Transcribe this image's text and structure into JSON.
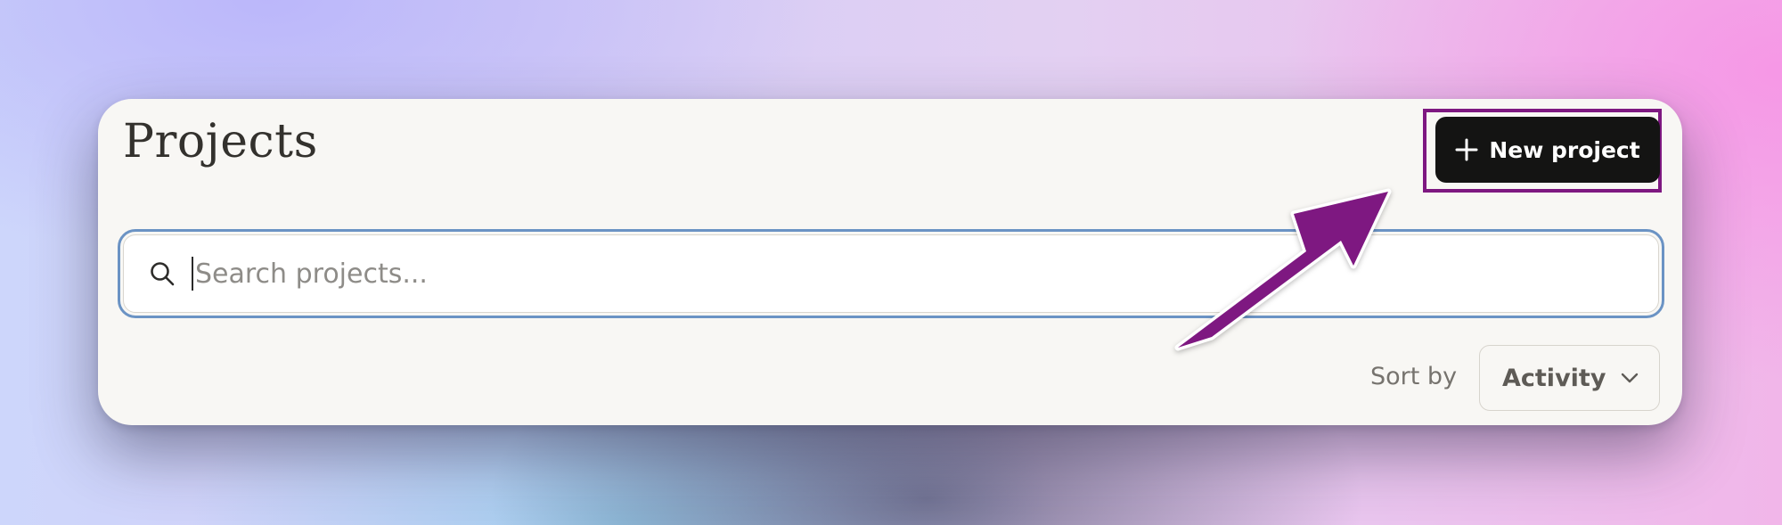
{
  "header": {
    "title": "Projects",
    "new_project_label": "New project"
  },
  "search": {
    "placeholder": "Search projects..."
  },
  "sort": {
    "label": "Sort by",
    "value": "Activity"
  },
  "icons": {
    "new_project": "plus-icon",
    "search": "search-icon",
    "sort_dropdown": "chevron-down-icon"
  },
  "colors": {
    "accent_focus_ring": "#6b93c4",
    "button_background": "#141413",
    "annotation": "#7e1881"
  }
}
